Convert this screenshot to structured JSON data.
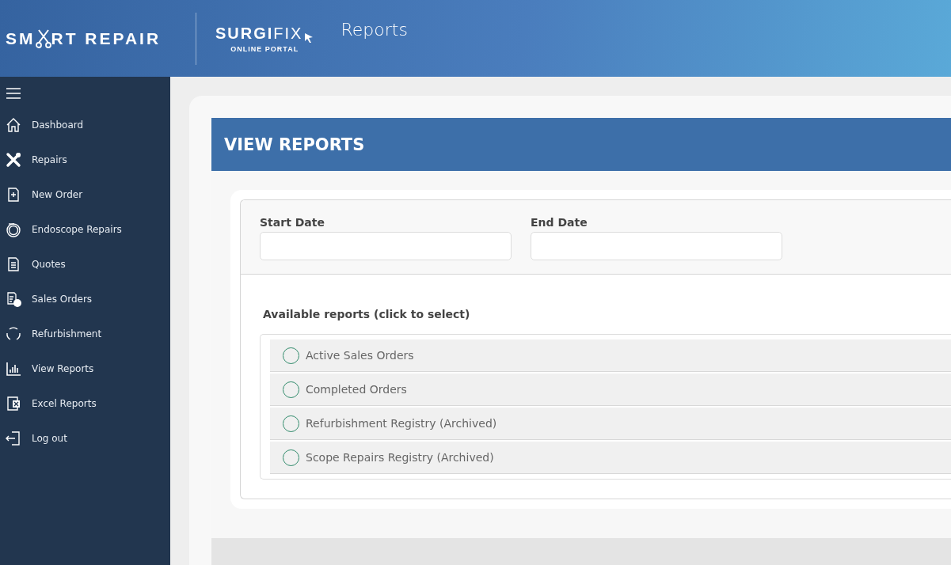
{
  "header": {
    "logo_left": "SM",
    "logo_right": "RT REPAIR",
    "brand": "**SURGI**FIX",
    "brand_sub": "ONLINE PORTAL",
    "page_title": "Reports"
  },
  "sidebar": {
    "items": [
      {
        "label": "Dashboard"
      },
      {
        "label": "Repairs"
      },
      {
        "label": "New Order"
      },
      {
        "label": "Endoscope Repairs"
      },
      {
        "label": "Quotes"
      },
      {
        "label": "Sales Orders"
      },
      {
        "label": "Refurbishment"
      },
      {
        "label": "View Reports"
      },
      {
        "label": "Excel Reports"
      },
      {
        "label": "Log out"
      }
    ]
  },
  "panel": {
    "title": "VIEW REPORTS",
    "fields": [
      {
        "label": "Start Date"
      },
      {
        "label": "End Date"
      }
    ],
    "reports_heading": "Available reports (click to select)",
    "reports": [
      {
        "label": "Active Sales Orders",
        "selected": false
      },
      {
        "label": "Completed Orders",
        "selected": false
      },
      {
        "label": "Refurbishment Registry (Archived)",
        "selected": false
      },
      {
        "label": "Scope Repairs Registry (Archived)",
        "selected": false
      }
    ]
  }
}
